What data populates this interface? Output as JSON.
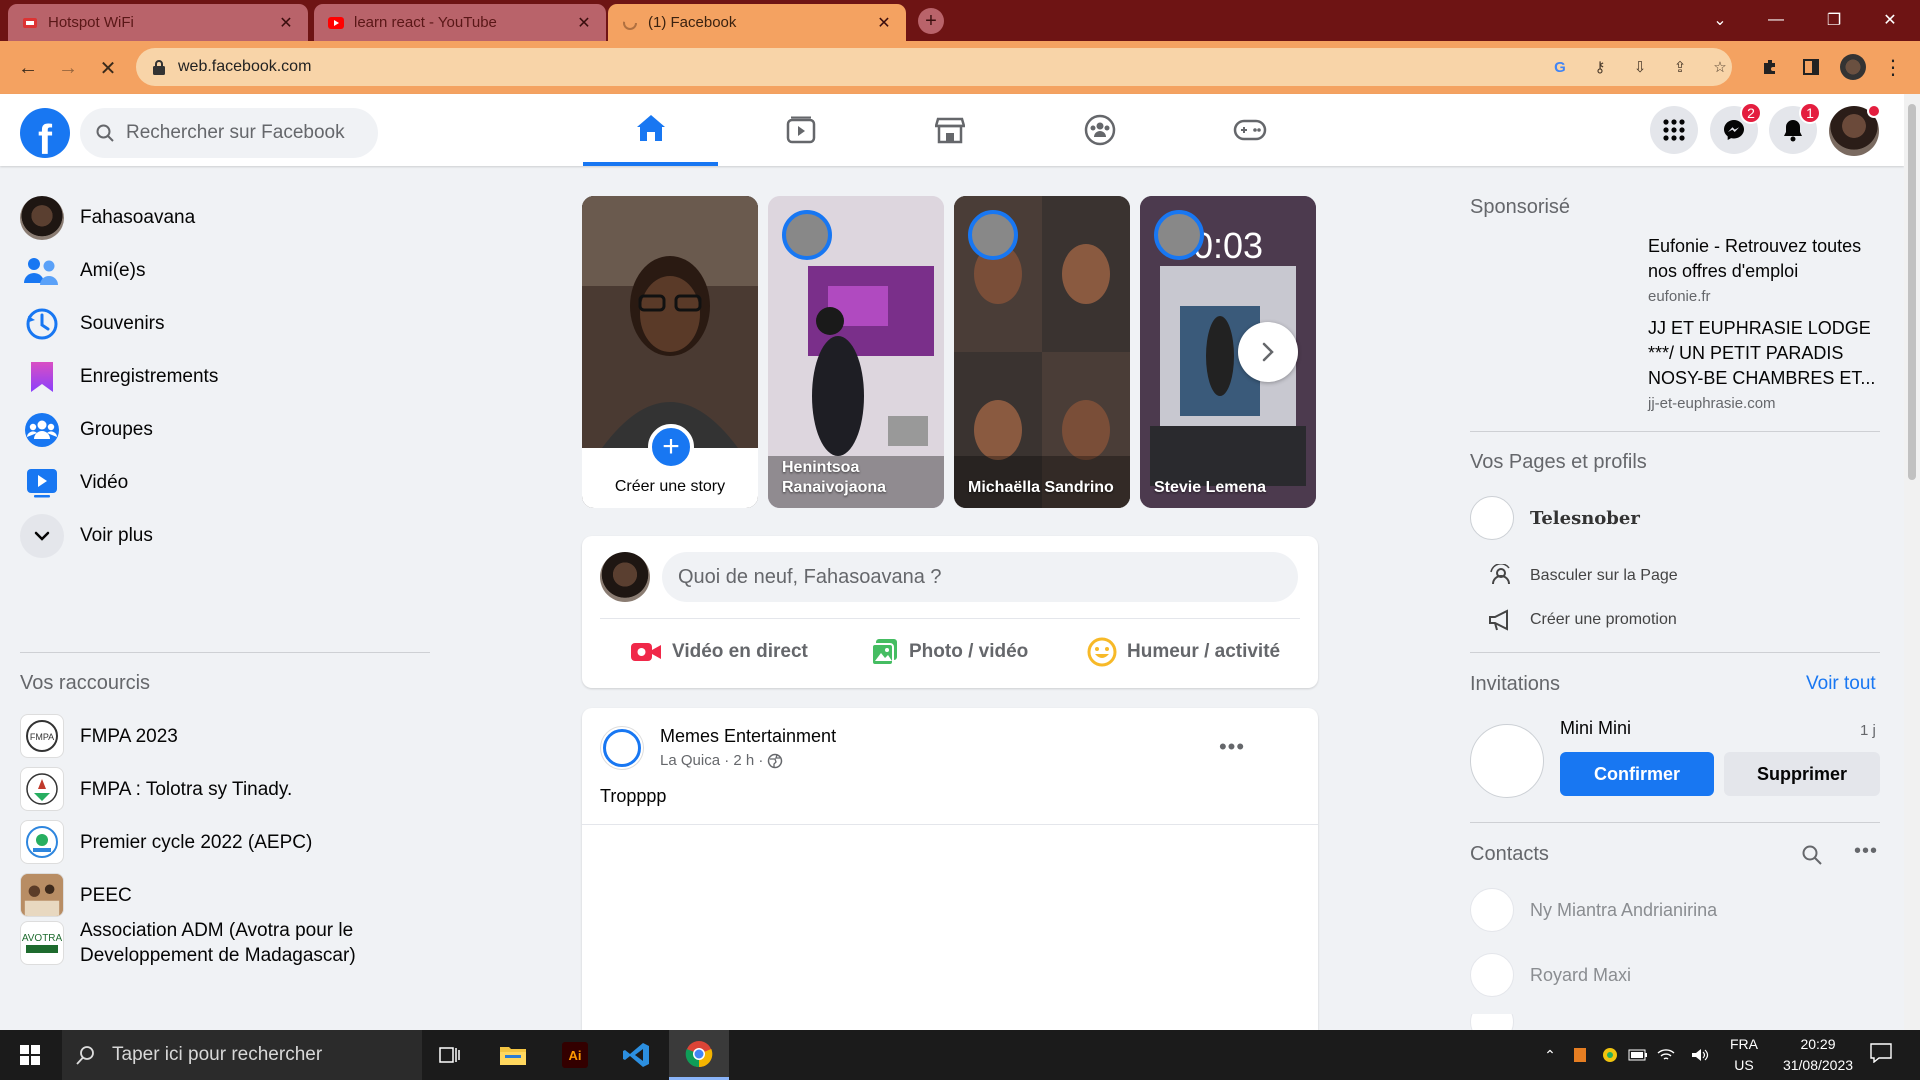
{
  "browser": {
    "tabs": [
      {
        "title": "Hotspot WiFi"
      },
      {
        "title": "learn react - YouTube"
      },
      {
        "title": "(1) Facebook"
      }
    ],
    "url": "web.facebook.com"
  },
  "header": {
    "search_placeholder": "Rechercher sur Facebook",
    "messenger_badge": "2",
    "notifications_badge": "1"
  },
  "left_nav": {
    "items": [
      {
        "label": "Fahasoavana",
        "icon": "profile-avatar"
      },
      {
        "label": "Ami(e)s",
        "icon": "friends-icon"
      },
      {
        "label": "Souvenirs",
        "icon": "memories-icon"
      },
      {
        "label": "Enregistrements",
        "icon": "bookmark-icon"
      },
      {
        "label": "Groupes",
        "icon": "groups-icon"
      },
      {
        "label": "Vidéo",
        "icon": "video-icon"
      },
      {
        "label": "Voir plus",
        "icon": "chevron-down-icon"
      }
    ],
    "shortcuts_title": "Vos raccourcis",
    "shortcuts": [
      {
        "label": "FMPA 2023"
      },
      {
        "label": "FMPA : Tolotra sy Tinady."
      },
      {
        "label": "Premier cycle 2022 (AEPC)"
      },
      {
        "label": "PEEC"
      },
      {
        "label": "Association ADM (Avotra pour le Developpement de Madagascar)"
      }
    ]
  },
  "stories": {
    "create_label": "Créer une story",
    "items": [
      {
        "name": "Henintsoa Ranaivojaona"
      },
      {
        "name": "Michaëlla Sandrino"
      },
      {
        "name": "Stevie Lemena"
      }
    ]
  },
  "composer": {
    "placeholder": "Quoi de neuf, Fahasoavana ?",
    "actions": [
      {
        "label": "Vidéo en direct"
      },
      {
        "label": "Photo / vidéo"
      },
      {
        "label": "Humeur / activité"
      }
    ]
  },
  "post": {
    "author": "Memes Entertainment",
    "meta": "La Quica · 2 h ·",
    "text": "Tropppp"
  },
  "right": {
    "sponsored_title": "Sponsorisé",
    "ads": [
      {
        "title": "Eufonie - Retrouvez toutes nos offres d'emploi",
        "url": "eufonie.fr"
      },
      {
        "title": "JJ ET EUPHRASIE LODGE ***/ UN PETIT PARADIS NOSY-BE CHAMBRES ET...",
        "url": "jj-et-euphrasie.com"
      }
    ],
    "pages_title": "Vos Pages et profils",
    "page_name": "Telesnober",
    "page_actions": [
      {
        "label": "Basculer sur la Page"
      },
      {
        "label": "Créer une promotion"
      }
    ],
    "invitations_title": "Invitations",
    "see_all": "Voir tout",
    "invite": {
      "name": "Mini Mini",
      "time": "1 j",
      "confirm": "Confirmer",
      "delete": "Supprimer"
    },
    "contacts_title": "Contacts",
    "contacts": [
      {
        "name": "Ny Miantra Andrianirina"
      },
      {
        "name": "Royard Maxi"
      }
    ]
  },
  "taskbar": {
    "search_placeholder": "Taper ici pour rechercher",
    "lang1": "FRA",
    "lang2": "US",
    "time": "20:29",
    "date": "31/08/2023"
  },
  "colors": {
    "facebook_blue": "#1877f2",
    "tab_strip": "#6e1414",
    "address_bar": "#f4a261"
  }
}
